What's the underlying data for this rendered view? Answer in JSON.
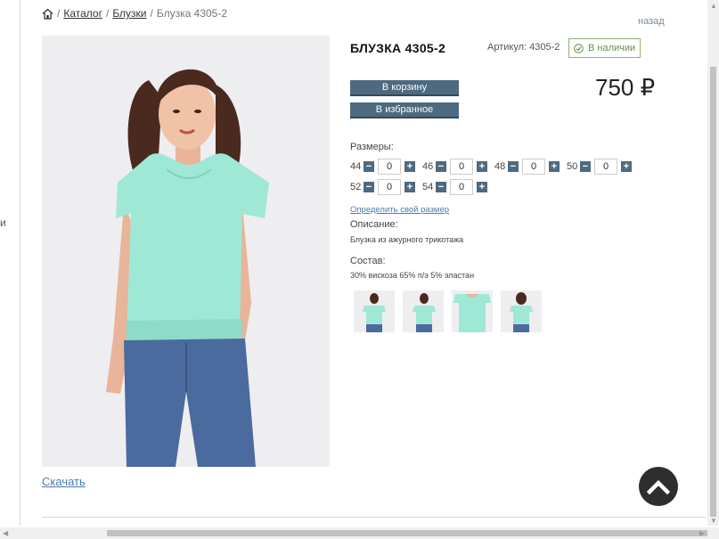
{
  "breadcrumb": {
    "items": [
      "Каталог",
      "Блузки",
      "Блузка 4305-2"
    ],
    "separator": "/"
  },
  "back_label": "назад",
  "left_edge_text": "и",
  "product": {
    "title": "БЛУЗКА 4305-2",
    "article": "Артикул: 4305-2",
    "stock": "В наличии",
    "price": "750 ₽",
    "add_to_cart": "В корзину",
    "add_to_favorites": "В избранное"
  },
  "sizes": {
    "label": "Размеры:",
    "items": [
      {
        "size": "44",
        "qty": "0"
      },
      {
        "size": "46",
        "qty": "0"
      },
      {
        "size": "48",
        "qty": "0"
      },
      {
        "size": "50",
        "qty": "0"
      },
      {
        "size": "52",
        "qty": "0"
      },
      {
        "size": "54",
        "qty": "0"
      }
    ],
    "determine_link": "Определить свой размер"
  },
  "description": {
    "label": "Описание:",
    "text": "Блузка из ажурного трикотажа"
  },
  "composition": {
    "label": "Состав:",
    "text": "30% вискоза 65% п/э 5% эластан"
  },
  "download_label": "Скачать",
  "colors": {
    "button_bg": "#4d6a80",
    "stock_green": "#6b8f4a",
    "link_blue": "#4b7bb0",
    "blouse_mint": "#9fe8d6"
  },
  "icons": {
    "home": "home-icon",
    "stock": "check-circle-icon",
    "scroll_top": "chevron-up-icon",
    "minus": "minus-icon",
    "plus": "plus-icon"
  }
}
